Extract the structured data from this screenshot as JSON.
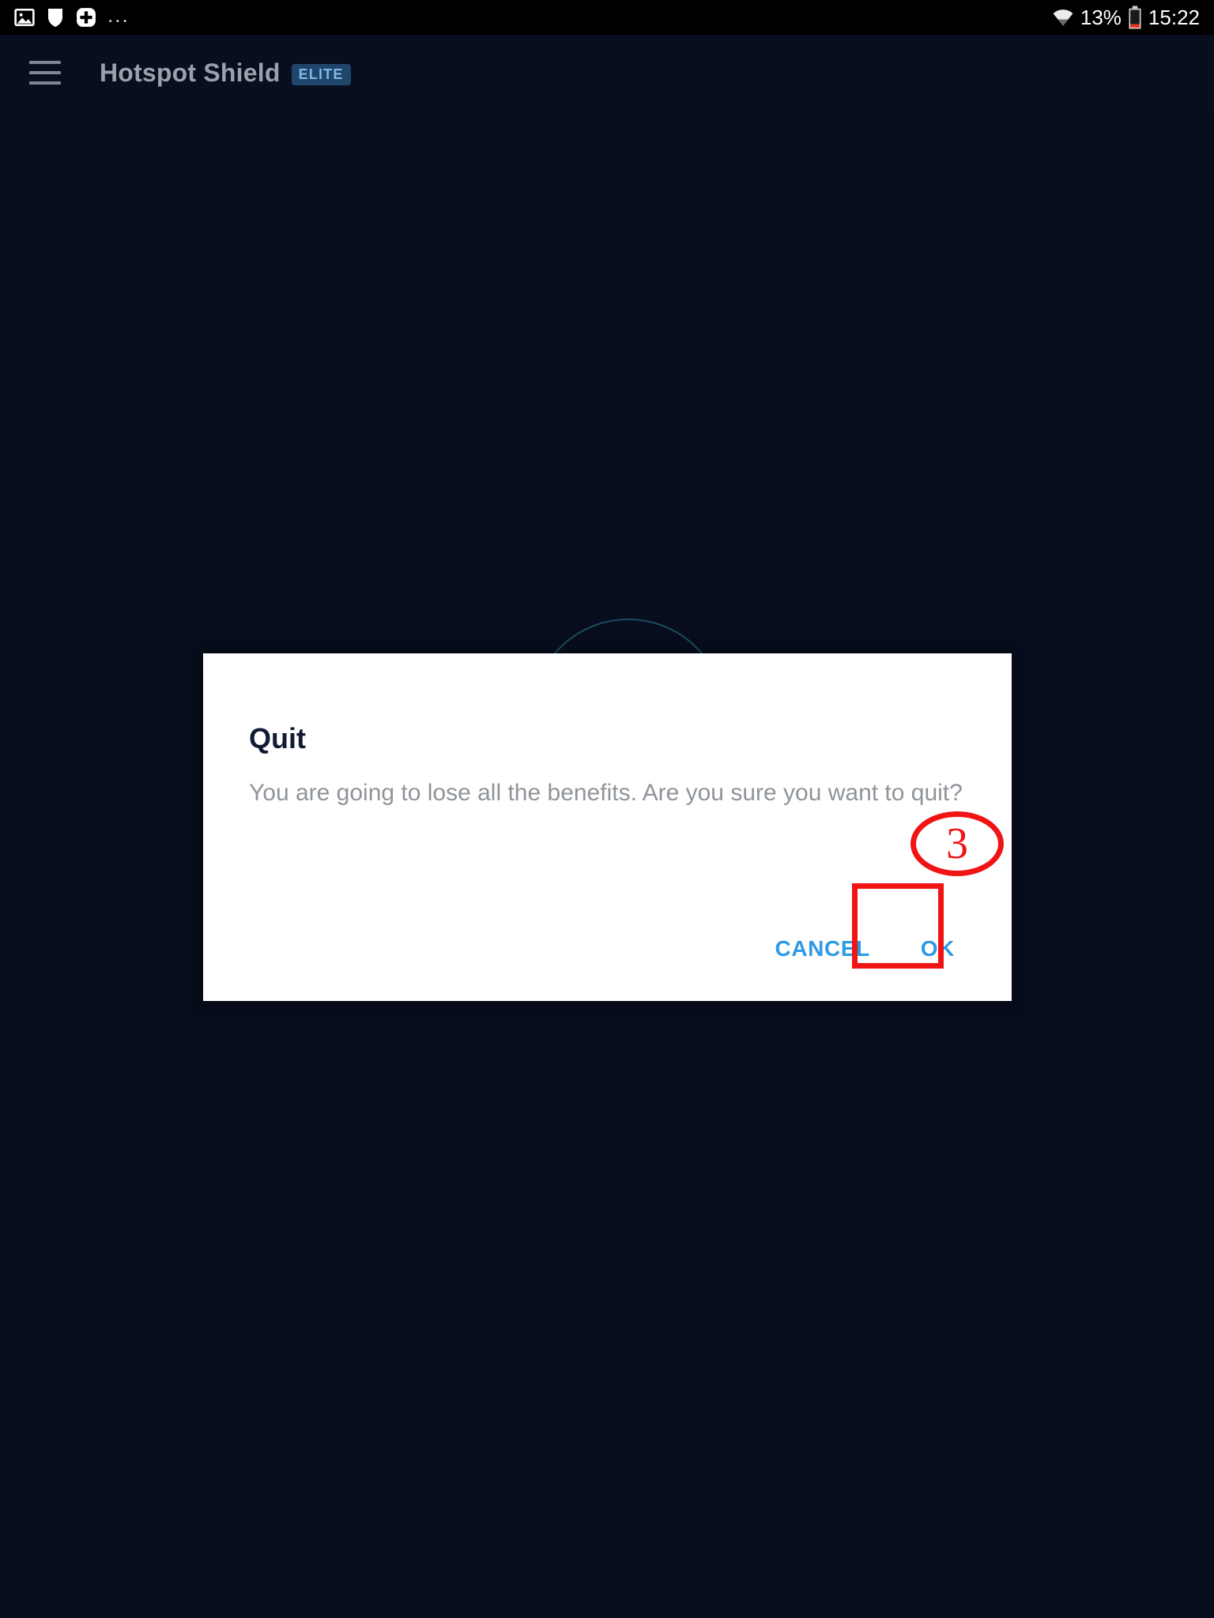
{
  "status_bar": {
    "icons_left": [
      "image-icon",
      "shield-icon",
      "plus-circle-icon"
    ],
    "ellipsis": "...",
    "wifi_icon": "wifi-icon",
    "battery_percent": "13%",
    "battery_icon": "battery-low-icon",
    "time": "15:22",
    "background": "#000000",
    "text_color": "#ffffff"
  },
  "app_bar": {
    "menu_icon": "hamburger-menu-icon",
    "title": "Hotspot Shield",
    "badge": "ELITE",
    "badge_bg": "#20456b",
    "badge_color": "#7fb6e8",
    "background": "#080e1d",
    "title_color": "#9aa1ac"
  },
  "dialog": {
    "title": "Quit",
    "message": "You are going to lose all the benefits. Are you sure you want to quit?",
    "cancel_label": "CANCEL",
    "ok_label": "OK",
    "background": "#ffffff",
    "title_color": "#121b33",
    "message_color": "#8f9499",
    "button_color": "#2e9ae6"
  },
  "annotation": {
    "step_number": "3",
    "color": "#f01414",
    "target": "ok-button"
  }
}
